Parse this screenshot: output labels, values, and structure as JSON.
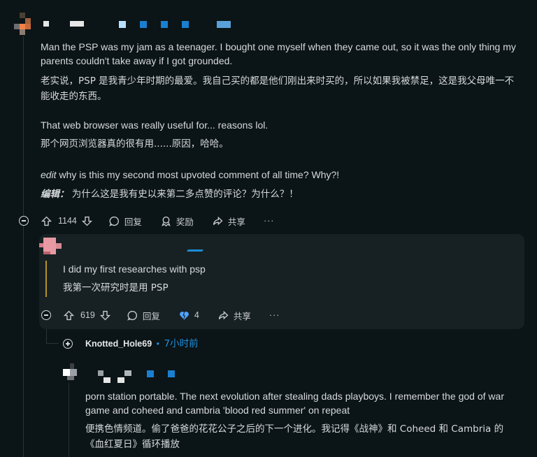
{
  "comment1": {
    "body_en_1": "Man the PSP was my jam as a teenager. I bought one myself when they came out, so it was the only thing my parents couldn't take away if I got grounded.",
    "body_zh_1": "老实说，PSP 是我青少年时期的最爱。我自己买的都是他们刚出来时买的，所以如果我被禁足，这是我父母唯一不能收走的东西。",
    "body_en_2": "That web browser was really useful for... reasons lol.",
    "body_zh_2": "那个网页浏览器真的很有用......原因，哈哈。",
    "edit_label_en": "edit",
    "edit_en": "why is this my second most upvoted comment of all time? Why?!",
    "edit_label_zh": "编辑：",
    "edit_zh": "为什么这是我有史以来第二多点赞的评论？为什么？！",
    "votes": "1144",
    "reply": "回复",
    "award": "奖励",
    "share": "共享",
    "more": "···"
  },
  "comment2": {
    "body_en": "I did my first researches with psp",
    "body_zh": "我第一次研究时是用 PSP",
    "votes": "619",
    "reply": "回复",
    "award_count": "4",
    "share": "共享",
    "more": "···"
  },
  "collapsed_reply": {
    "username": "Knotted_Hole69",
    "separator": "•",
    "time": "7小时前"
  },
  "comment3": {
    "body_en": "porn station portable. The next evolution after stealing dads playboys. I remember the god of war game and coheed and cambria 'blood red summer' on repeat",
    "body_zh": "便携色情频道。偷了爸爸的花花公子之后的下一个进化。我记得《战神》和 Coheed 和 Cambria 的《血红夏日》循环播放"
  },
  "colors": {
    "background": "#0b1416",
    "highlight": "#172123",
    "accent_blue": "#1d8bd6",
    "username_link": "#1e90e0",
    "award_heart": "#4fa3ff"
  }
}
